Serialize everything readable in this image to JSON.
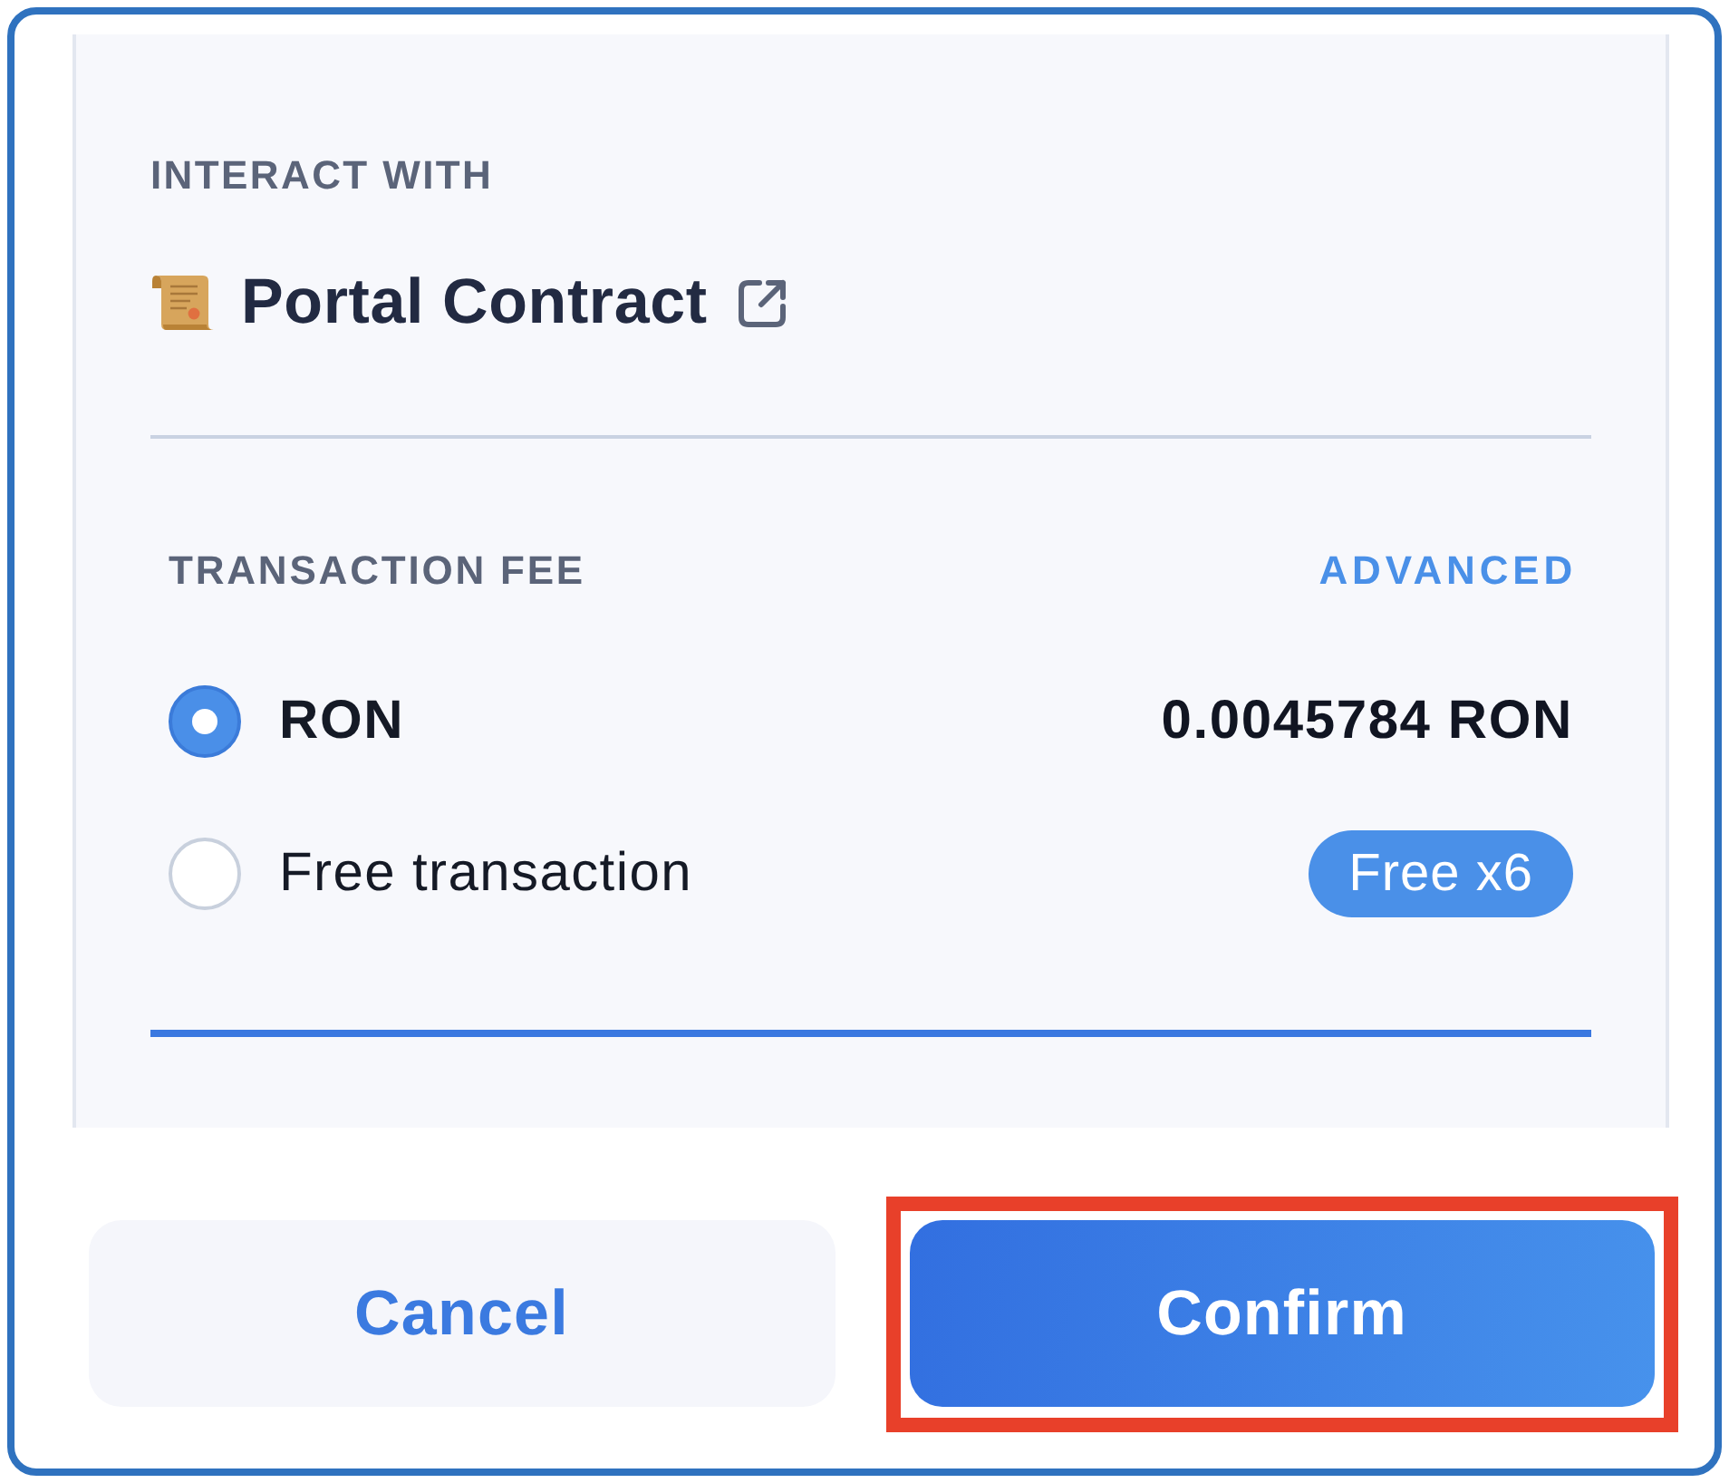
{
  "interact": {
    "label": "INTERACT WITH",
    "contract_name": "Portal Contract"
  },
  "fee": {
    "title": "TRANSACTION FEE",
    "advanced_link": "ADVANCED",
    "options": [
      {
        "kind": "amount",
        "label": "RON",
        "selected": true,
        "detail": "0.0045784 RON"
      },
      {
        "kind": "badge",
        "label": "Free transaction",
        "selected": false,
        "detail": "Free x6"
      }
    ]
  },
  "buttons": [
    {
      "label": "Cancel",
      "kind": "secondary",
      "highlighted": false
    },
    {
      "label": "Confirm",
      "kind": "primary",
      "highlighted": true
    }
  ]
}
